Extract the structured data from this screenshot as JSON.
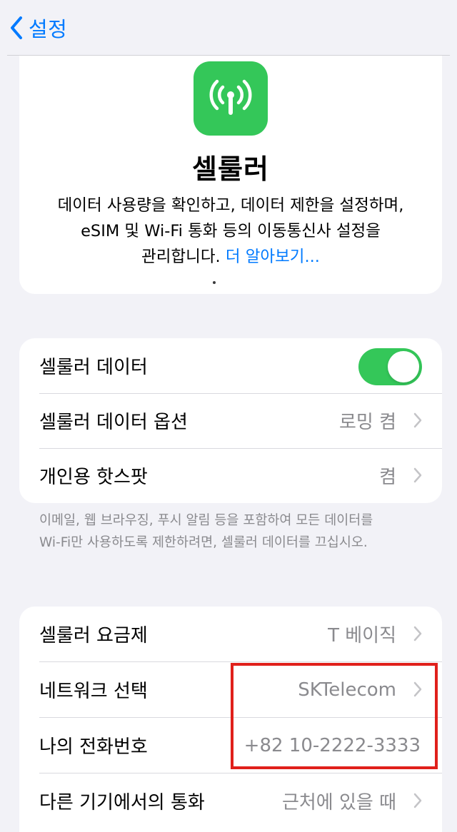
{
  "nav": {
    "back_label": "설정"
  },
  "hero": {
    "icon": "antenna-icon",
    "title": "셀룰러",
    "desc_line1": "데이터 사용량을 확인하고, 데이터 제한을 설정하며,",
    "desc_line2": "eSIM 및 Wi-Fi 통화 등의 이동통신사 설정을",
    "desc_line3": "관리합니다.",
    "link": "더 알아보기..."
  },
  "group1": {
    "cellular_data": {
      "label": "셀룰러 데이터",
      "toggle_on": true
    },
    "cellular_options": {
      "label": "셀룰러 데이터 옵션",
      "value": "로밍 켬"
    },
    "hotspot": {
      "label": "개인용 핫스팟",
      "value": "켬"
    }
  },
  "footnote": {
    "line1": "이메일, 웹 브라우징, 푸시 알림 등을 포함하여 모든 데이터를",
    "line2": "Wi-Fi만 사용하도록 제한하려면, 셀룰러 데이터를 끄십시오."
  },
  "group2": {
    "plan": {
      "label": "셀룰러 요금제",
      "value": "T 베이직"
    },
    "network": {
      "label": "네트워크 선택",
      "value": "SKTelecom"
    },
    "phone_number": {
      "label": "나의 전화번호",
      "value": "+82 10-2222-3333"
    },
    "other_devices": {
      "label": "다른 기기에서의 통화",
      "value": "근처에 있을 때"
    }
  },
  "colors": {
    "accent": "#007aff",
    "green": "#34c759",
    "highlight": "#e0201b"
  }
}
